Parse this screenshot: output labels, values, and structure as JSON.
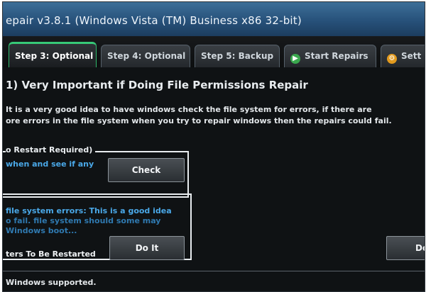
{
  "window": {
    "title": "epair v3.8.1 (Windows Vista (TM) Business x86 32-bit)"
  },
  "tabs": [
    {
      "label": "Step 3: Optional",
      "active": true,
      "icon": ""
    },
    {
      "label": "Step 4: Optional",
      "active": false,
      "icon": ""
    },
    {
      "label": "Step 5: Backup",
      "active": false,
      "icon": ""
    },
    {
      "label": "Start Repairs",
      "active": false,
      "icon": "start-repairs-icon"
    },
    {
      "label": "Sett",
      "active": false,
      "icon": "settings-icon"
    }
  ],
  "section": {
    "heading": "1) Very Important if Doing File Permissions Repair",
    "desc_line1": "It is a very good idea to have windows check the file system for errors, if there are",
    "desc_line2": "ore errors in the file system when you try to repair windows then the repairs could fail."
  },
  "group1": {
    "legend": "o Restart Required)",
    "blue_text": "when and see if any",
    "button": "Check"
  },
  "group2": {
    "blue_line1": "file system errors: This is a good idea",
    "blue_line2": "o fail. file system should some may",
    "blue_line3": "Windows boot...",
    "label": "ters To Be Restarted",
    "button": "Do It"
  },
  "right_button": "Do",
  "status_text": "Windows supported.",
  "colors": {
    "accent_green": "#37c977",
    "link_blue": "#4aa8e8",
    "title_blue": "#2d5b86"
  }
}
